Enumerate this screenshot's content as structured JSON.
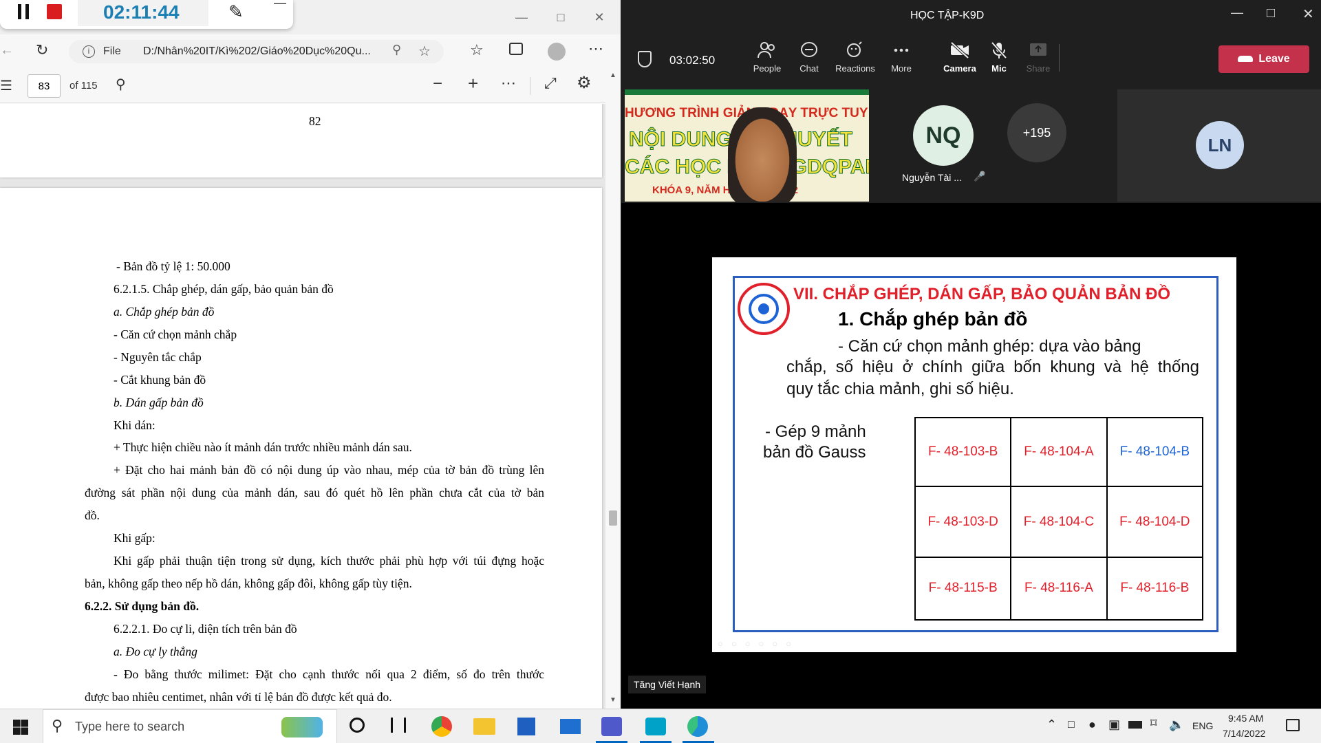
{
  "recorder": {
    "timer": "02:11:44"
  },
  "edge": {
    "address_label": "File",
    "address": "D:/Nhân%20IT/Kì%202/Giáo%20Dục%20Qu...",
    "page_input": "83",
    "page_total": "of 115"
  },
  "pdf": {
    "page_number": "82",
    "lines": [
      "- Bản đồ tỷ lệ 1:        50.000",
      "6.2.1.5. Chắp ghép, dán gấp, bảo quản bản đồ",
      "a. Chắp ghép bản đồ",
      "- Căn cứ chọn mảnh chắp",
      "- Nguyên tắc chắp",
      "- Cắt khung bản đồ",
      "b. Dán gấp bản đồ",
      "Khi dán:",
      "+ Thực hiện chiều nào ít mảnh dán trước nhiều mảnh dán sau.",
      "+ Đặt cho hai mảnh bản đồ có nội dung úp vào nhau, mép của tờ bản đồ trùng lên",
      "đường sát phần nội dung của mảnh dán, sau đó quét hồ lên phần chưa cắt của tờ bản",
      "đồ.",
      "Khi gấp:",
      "Khi gấp phải thuận tiện trong sử dụng, kích thước phải phù hợp với túi đựng hoặc",
      "bản, không gấp theo nếp hồ dán, không gấp đôi, không gấp tùy tiện.",
      "6.2.2. Sử dụng bản đồ.",
      "6.2.2.1. Đo cự li, diện tích trên bản đồ",
      "a. Đo cự ly thẳng",
      "- Đo bằng thước milimet: Đặt cho cạnh thước nối qua 2 điểm, số đo trên thước",
      "được bao nhiêu centimet, nhân với tỉ lệ bản đồ được kết quả đo."
    ]
  },
  "teams": {
    "title": "HỌC TẬP-K9D",
    "meeting_time": "03:02:50",
    "toolbar": {
      "people": "People",
      "chat": "Chat",
      "reactions": "Reactions",
      "more": "More",
      "camera": "Camera",
      "mic": "Mic",
      "share": "Share",
      "leave": "Leave"
    },
    "participants": {
      "nq_initials": "NQ",
      "nq_name": "Nguyễn Tài ...",
      "overflow": "+195",
      "ln_initials": "LN"
    },
    "video_banner": {
      "line1": "HƯƠNG TRÌNH GIẢNG DẠY TRỰC TUY",
      "line2": "NỘI DUNG LÝ THUYẾT",
      "line3": "CÁC HỌC PHẦN GDQPAN",
      "line4": "KHÓA 9, NĂM HỌC 2021-2022"
    },
    "presenter_label": "Tăng Viết Hạnh",
    "slide": {
      "title": "VII. CHẮP GHÉP, DÁN GẤP, BẢO QUẢN BẢN ĐỒ",
      "subtitle": "1. Chắp ghép bản đồ",
      "para_line1": "- Căn cứ chọn mảnh ghép: dựa vào bảng",
      "para_line2": "chắp, số hiệu ở chính giữa bốn khung và hệ thống",
      "para_line3": "quy tắc chia mảnh, ghi số hiệu.",
      "left_line1": "- Gép 9 mảnh",
      "left_line2": "bản đồ Gauss",
      "grid": [
        [
          "F- 48-103-B",
          "F- 48-104-A",
          "F- 48-104-B"
        ],
        [
          "F- 48-103-D",
          "F- 48-104-C",
          "F- 48-104-D"
        ],
        [
          "F- 48-115-B",
          "F- 48-116-A",
          "F- 48-116-B"
        ]
      ]
    }
  },
  "taskbar": {
    "search_placeholder": "Type here to search",
    "language": "ENG",
    "time": "9:45 AM",
    "date": "7/14/2022"
  },
  "colors": {
    "slide_title": "#e0202a",
    "slide_border": "#2c5fbd",
    "grid_red": "#e0202a",
    "grid_blue": "#1d63d6",
    "leave": "#c4314b",
    "timer": "#1b7fb3"
  }
}
